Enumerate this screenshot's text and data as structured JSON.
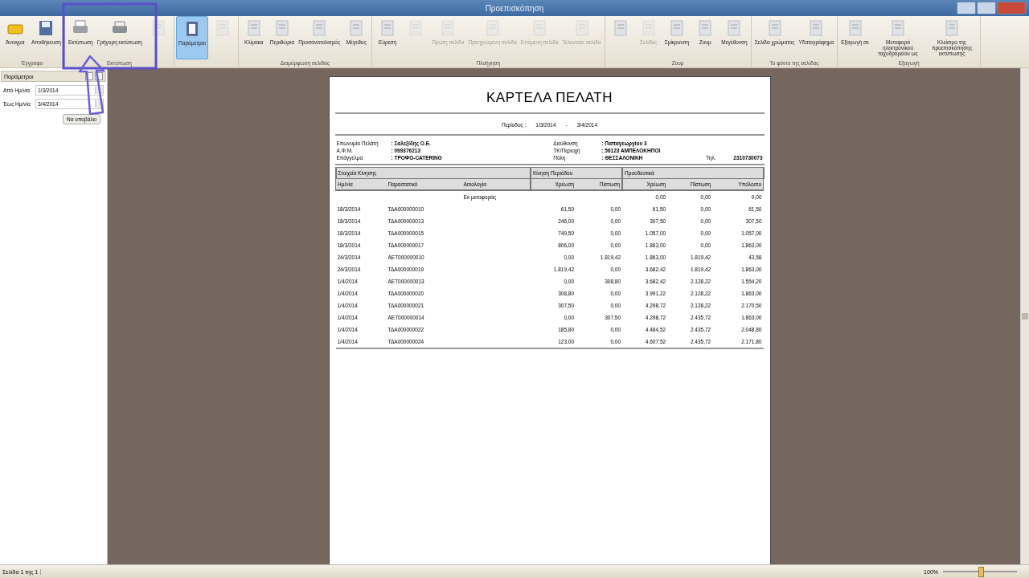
{
  "window": {
    "title": "Προεπισκόπηση"
  },
  "ribbon": {
    "groups": [
      {
        "label": "Έγγραφο",
        "buttons": [
          {
            "label": "Άνοιγμα",
            "disabled": false,
            "selected": false
          },
          {
            "label": "Αποθήκευση",
            "disabled": false,
            "selected": false
          }
        ]
      },
      {
        "label": "Εκτύπωση",
        "buttons": [
          {
            "label": "Εκτύπωση",
            "disabled": false,
            "selected": false
          },
          {
            "label": "Γρήγορη εκτύπωση",
            "disabled": false,
            "selected": false
          },
          {
            "disabled": true,
            "selected": false
          }
        ]
      },
      {
        "buttons": [
          {
            "label": "Παράμετροι",
            "disabled": false,
            "selected": true
          },
          {
            "disabled": true,
            "selected": false
          }
        ]
      },
      {
        "label": "Διαμόρφωση σελίδας",
        "buttons": [
          {
            "label": "Κλίμακα",
            "disabled": false,
            "selected": false
          },
          {
            "label": "Περιθώρια",
            "disabled": false,
            "selected": false
          },
          {
            "label": "Προσανατολισμός",
            "disabled": false,
            "selected": false
          },
          {
            "label": "Μέγεθος",
            "disabled": false,
            "selected": false
          }
        ]
      },
      {
        "label": "Πλοήγηση",
        "buttons": [
          {
            "label": "Εύρεση",
            "disabled": false,
            "selected": false
          },
          {
            "disabled": true,
            "selected": false
          },
          {
            "label": "Πρώτη σελίδα",
            "disabled": true,
            "selected": false
          },
          {
            "label": "Προηγούμενη σελίδα",
            "disabled": true,
            "selected": false
          },
          {
            "label": "Επόμενη σελίδα",
            "disabled": true,
            "selected": false
          },
          {
            "label": "Τελευταία σελίδα",
            "disabled": true,
            "selected": false
          }
        ]
      },
      {
        "label": "Ζουμ",
        "buttons": [
          {
            "disabled": false,
            "selected": false
          },
          {
            "label": "Σελίδες",
            "disabled": true,
            "selected": false
          },
          {
            "label": "Σμίκρυνση",
            "disabled": false,
            "selected": false
          },
          {
            "label": "Ζουμ",
            "disabled": false,
            "selected": false
          },
          {
            "label": "Μεγέθυνση",
            "disabled": false,
            "selected": false
          }
        ]
      },
      {
        "label": "Το φόντο της σελίδας",
        "buttons": [
          {
            "label": "Σελίδα χρώματος",
            "disabled": false,
            "selected": false
          },
          {
            "label": "Υδατογράφημα",
            "disabled": false,
            "selected": false
          }
        ]
      },
      {
        "label": "Εξαγωγή",
        "buttons": [
          {
            "label": "Εξαγωγή σε",
            "disabled": false,
            "selected": false
          },
          {
            "label": "Μεταφορά ηλεκτρονικού ταχυδρομείου ως",
            "disabled": false,
            "selected": false
          },
          {
            "label": "Κλείσιμο της προεπισκόπησης εκτύπωσης",
            "disabled": false,
            "selected": false
          }
        ]
      }
    ]
  },
  "parameters_panel": {
    "title": "Παράμετροι",
    "fields": [
      {
        "label": "Από Ημ/νία",
        "value": "1/3/2014"
      },
      {
        "label": "Έως Ημ/νία",
        "value": "3/4/2014"
      }
    ],
    "submit": "Να υποβάλει"
  },
  "report": {
    "title": "ΚΑΡΤΕΛΑ ΠΕΛΑΤΗ",
    "period_label": "Περίοδος :",
    "period_from": "1/3/2014",
    "period_sep": "-",
    "period_to": "3/4/2014",
    "info_left": [
      {
        "label": "Επωνυμία Πελάτη",
        "value": ": Σαλεξίδης Ο.Ε."
      },
      {
        "label": "Α.Φ.Μ.",
        "value": ": 099376213"
      },
      {
        "label": "Επάγγελμα",
        "value": ": ΤΡΟΦΟ-CATERING"
      }
    ],
    "info_right": [
      {
        "label": "Διεύθυνση",
        "value": ": Παπαγεωργίου 3"
      },
      {
        "label": "ΤΚ/Περιοχή",
        "value": ": 56123 ΑΜΠΕΛΟΚΗΠΟΙ"
      },
      {
        "label": "Πόλη",
        "value": ": ΘΕΣΣΑΛΟΝΙΚΗ"
      }
    ],
    "phone_label": "Τηλ.",
    "phone": "2310730073",
    "group_headers": [
      "Στοιχεία Κίνησης",
      "Κίνηση Περιόδου",
      "Προοδευτικά"
    ],
    "columns": [
      "Ημ/νία",
      "Παραστατικό",
      "Αιτιολογία",
      "Χρέωση",
      "Πίστωση",
      "Χρέωση",
      "Πίστωση",
      "Υπόλοιπο"
    ],
    "carry_forward": {
      "label": "Εκ μεταφοράς",
      "values": [
        "0,00",
        "0,00",
        "0,00"
      ]
    },
    "rows": [
      [
        "18/3/2014",
        "ΤΔΑ000000010",
        "",
        "61,50",
        "0,00",
        "61,50",
        "0,00",
        "61,50"
      ],
      [
        "18/3/2014",
        "ΤΔΑ000000013",
        "",
        "246,00",
        "0,00",
        "307,50",
        "0,00",
        "307,50"
      ],
      [
        "18/3/2014",
        "ΤΔΑ000000015",
        "",
        "749,50",
        "0,00",
        "1.057,00",
        "0,00",
        "1.057,00"
      ],
      [
        "18/3/2014",
        "ΤΔΑ000000017",
        "",
        "806,00",
        "0,00",
        "1.863,00",
        "0,00",
        "1.863,00"
      ],
      [
        "24/3/2014",
        "ΑΕΤ000000010",
        "",
        "0,00",
        "1.819,42",
        "1.863,00",
        "1.819,42",
        "43,58"
      ],
      [
        "24/3/2014",
        "ΤΔΑ000000019",
        "",
        "1.819,42",
        "0,00",
        "3.682,42",
        "1.819,42",
        "1.863,00"
      ],
      [
        "1/4/2014",
        "ΑΕΤ000000013",
        "",
        "0,00",
        "308,80",
        "3.682,42",
        "2.128,22",
        "1.554,20"
      ],
      [
        "1/4/2014",
        "ΤΔΑ000000020",
        "",
        "308,80",
        "0,00",
        "3.991,22",
        "2.128,22",
        "1.863,00"
      ],
      [
        "1/4/2014",
        "ΤΔΑ000000021",
        "",
        "307,50",
        "0,00",
        "4.298,72",
        "2.128,22",
        "2.170,50"
      ],
      [
        "1/4/2014",
        "ΑΕΤ000000014",
        "",
        "0,00",
        "307,50",
        "4.298,72",
        "2.435,72",
        "1.863,00"
      ],
      [
        "1/4/2014",
        "ΤΔΑ000000022",
        "",
        "185,80",
        "0,00",
        "4.484,52",
        "2.435,72",
        "2.048,80"
      ],
      [
        "1/4/2014",
        "ΤΔΑ000000024",
        "",
        "123,00",
        "0,00",
        "4.607,52",
        "2.435,72",
        "2.171,80"
      ]
    ]
  },
  "status_bar": {
    "page": "Σελίδα 1 της 1",
    "zoom": "100%",
    "zoom_level": {
      "level": 0.5
    }
  }
}
